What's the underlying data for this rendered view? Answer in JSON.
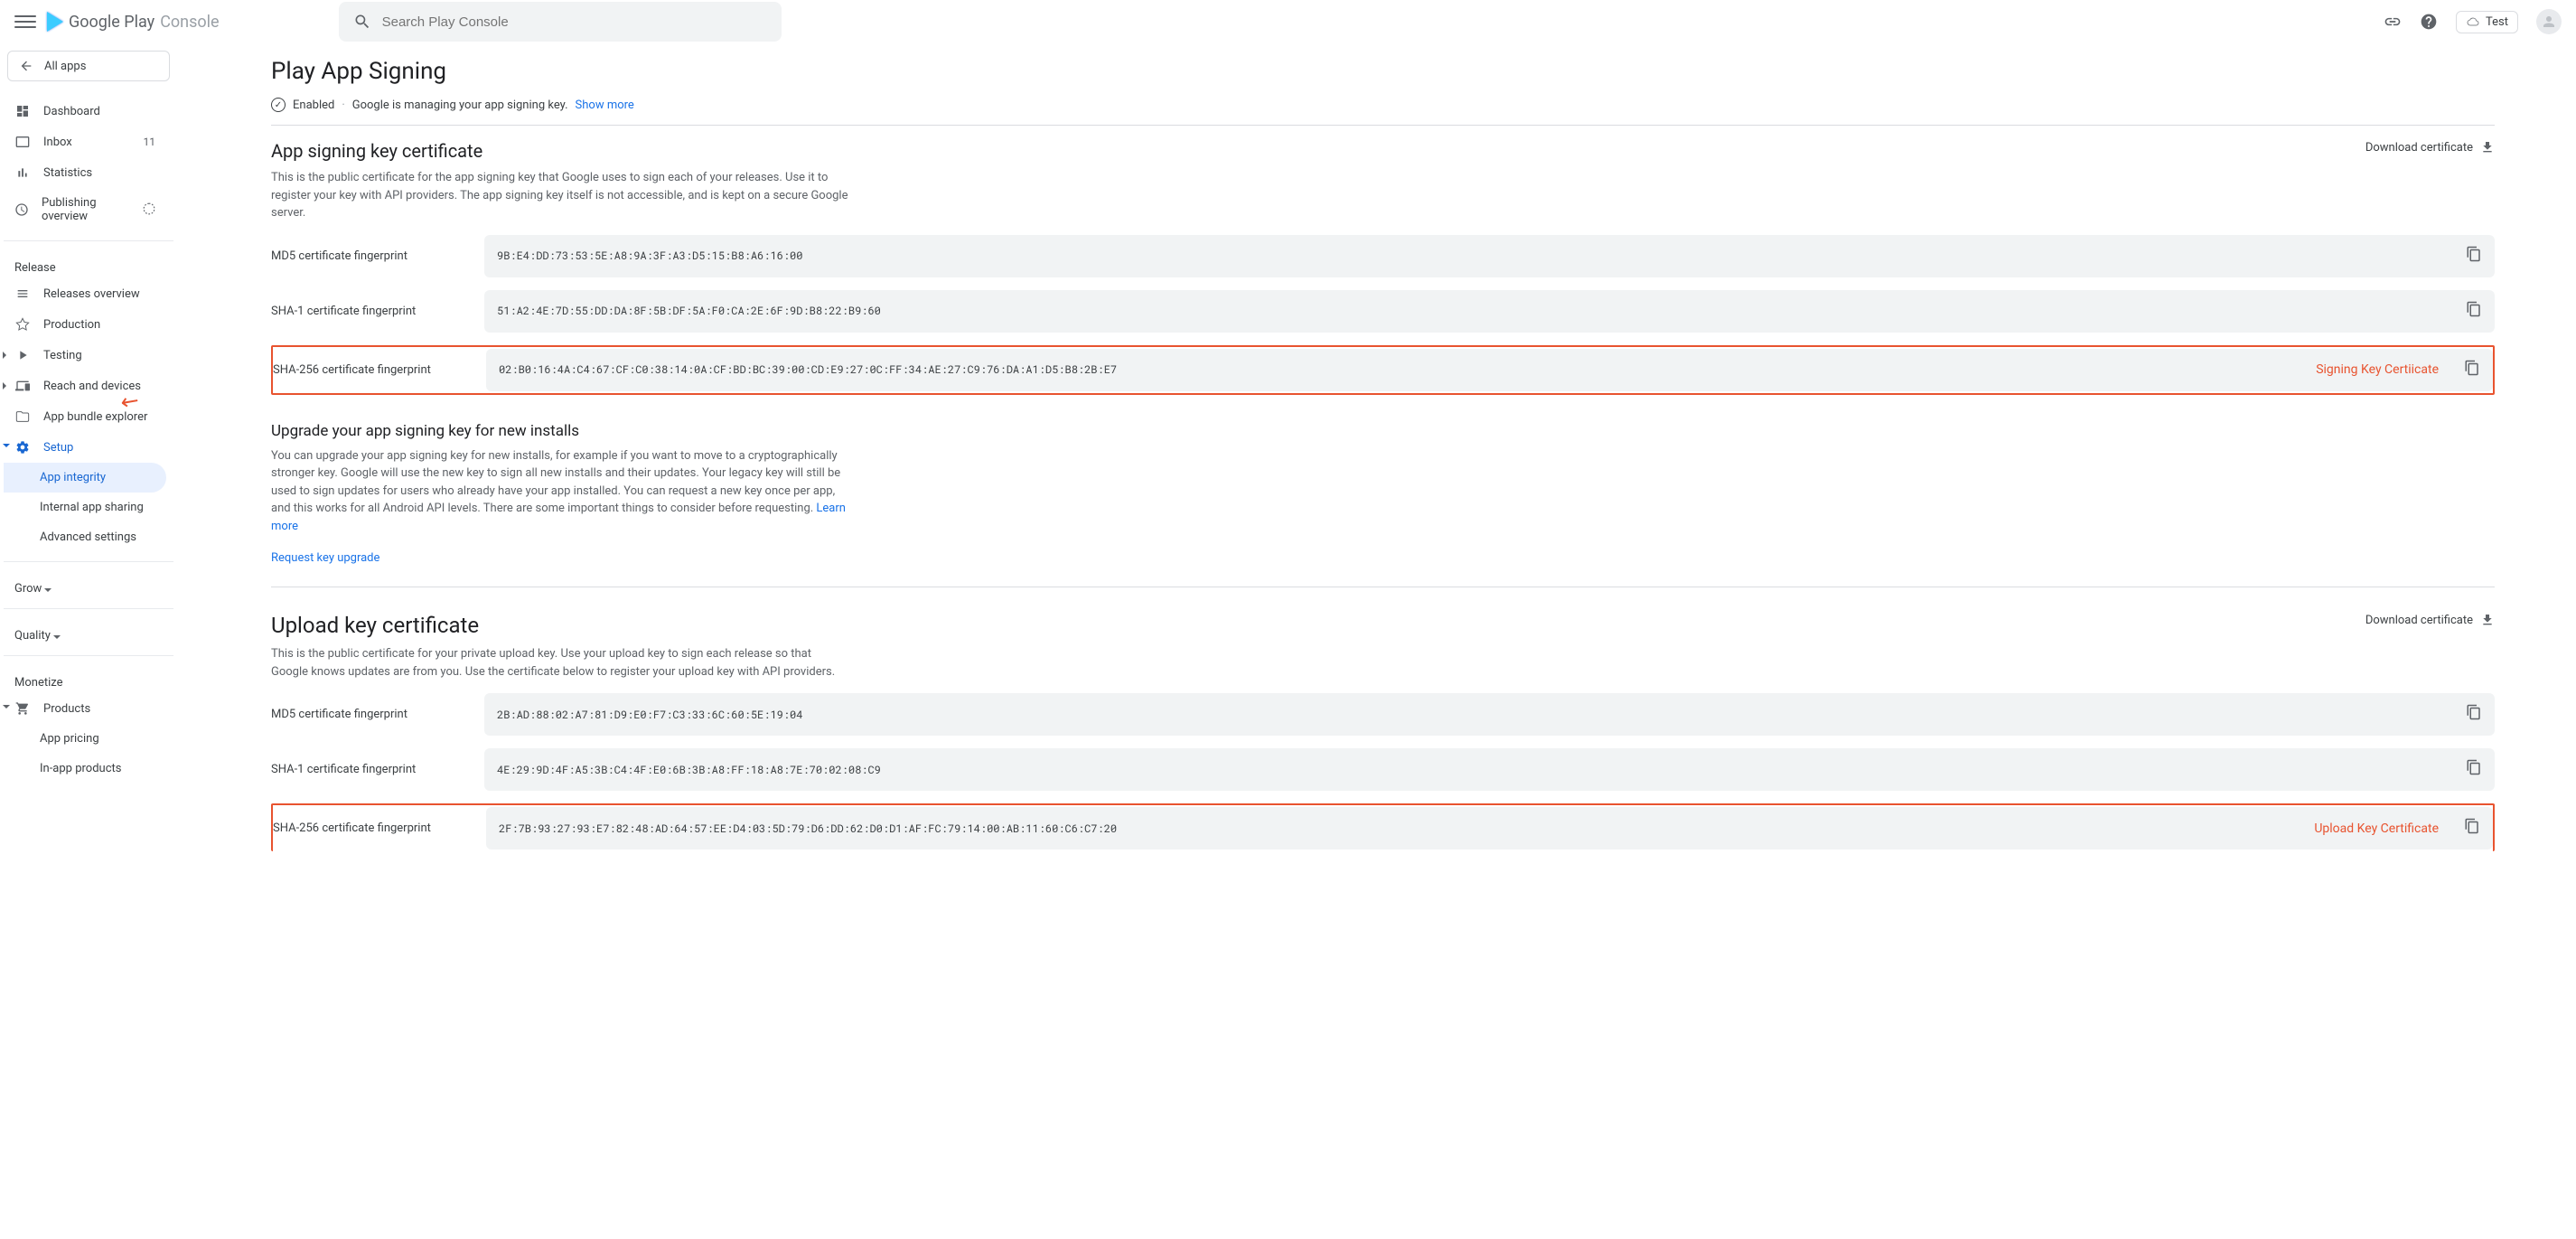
{
  "header": {
    "product_name": "Google Play",
    "product_suffix": "Console",
    "search_placeholder": "Search Play Console",
    "test_label": "Test"
  },
  "sidebar": {
    "all_apps": "All apps",
    "items": [
      {
        "label": "Dashboard"
      },
      {
        "label": "Inbox",
        "badge": "11"
      },
      {
        "label": "Statistics"
      },
      {
        "label": "Publishing overview"
      }
    ],
    "release_header": "Release",
    "release_items": [
      {
        "label": "Releases overview"
      },
      {
        "label": "Production"
      },
      {
        "label": "Testing"
      },
      {
        "label": "Reach and devices"
      },
      {
        "label": "App bundle explorer"
      },
      {
        "label": "Setup"
      }
    ],
    "setup_sub": [
      {
        "label": "App integrity"
      },
      {
        "label": "Internal app sharing"
      },
      {
        "label": "Advanced settings"
      }
    ],
    "grow": "Grow",
    "quality": "Quality",
    "monetize": "Monetize",
    "monetize_items": [
      {
        "label": "Products"
      },
      {
        "label": "App pricing"
      },
      {
        "label": "In-app products"
      }
    ]
  },
  "page": {
    "title": "Play App Signing",
    "status_enabled": "Enabled",
    "status_desc": "Google is managing your app signing key.",
    "show_more": "Show more",
    "signing": {
      "title": "App signing key certificate",
      "desc": "This is the public certificate for the app signing key that Google uses to sign each of your releases. Use it to register your key with API providers. The app signing key itself is not accessible, and is kept on a secure Google server.",
      "download": "Download certificate",
      "rows": [
        {
          "label": "MD5 certificate fingerprint",
          "value": "9B:E4:DD:73:53:5E:A8:9A:3F:A3:D5:15:B8:A6:16:00"
        },
        {
          "label": "SHA-1 certificate fingerprint",
          "value": "51:A2:4E:7D:55:DD:DA:8F:5B:DF:5A:F0:CA:2E:6F:9D:B8:22:B9:60"
        },
        {
          "label": "SHA-256 certificate fingerprint",
          "value": "02:B0:16:4A:C4:67:CF:C0:38:14:0A:CF:BD:BC:39:00:CD:E9:27:0C:FF:34:AE:27:C9:76:DA:A1:D5:B8:2B:E7"
        }
      ],
      "highlight_label": "Signing Key Certiicate"
    },
    "upgrade": {
      "title": "Upgrade your app signing key for new installs",
      "desc": "You can upgrade your app signing key for new installs, for example if you want to move to a cryptographically stronger key. Google will use the new key to sign all new installs and their updates. Your legacy key will still be used to sign updates for users who already have your app installed. You can request a new key once per app, and this works for all Android API levels. There are some important things to consider before requesting.",
      "learn_more": "Learn more",
      "request": "Request key upgrade"
    },
    "upload": {
      "title": "Upload key certificate",
      "desc": "This is the public certificate for your private upload key. Use your upload key to sign each release so that Google knows updates are from you. Use the certificate below to register your upload key with API providers.",
      "download": "Download certificate",
      "rows": [
        {
          "label": "MD5 certificate fingerprint",
          "value": "2B:AD:88:02:A7:81:D9:E0:F7:C3:33:6C:60:5E:19:04"
        },
        {
          "label": "SHA-1 certificate fingerprint",
          "value": "4E:29:9D:4F:A5:3B:C4:4F:E0:6B:3B:A8:FF:18:A8:7E:70:02:08:C9"
        },
        {
          "label": "SHA-256 certificate fingerprint",
          "value": "2F:7B:93:27:93:E7:82:48:AD:64:57:EE:D4:03:5D:79:D6:DD:62:D0:D1:AF:FC:79:14:00:AB:11:60:C6:C7:20"
        }
      ],
      "highlight_label": "Upload Key Certificate"
    }
  }
}
